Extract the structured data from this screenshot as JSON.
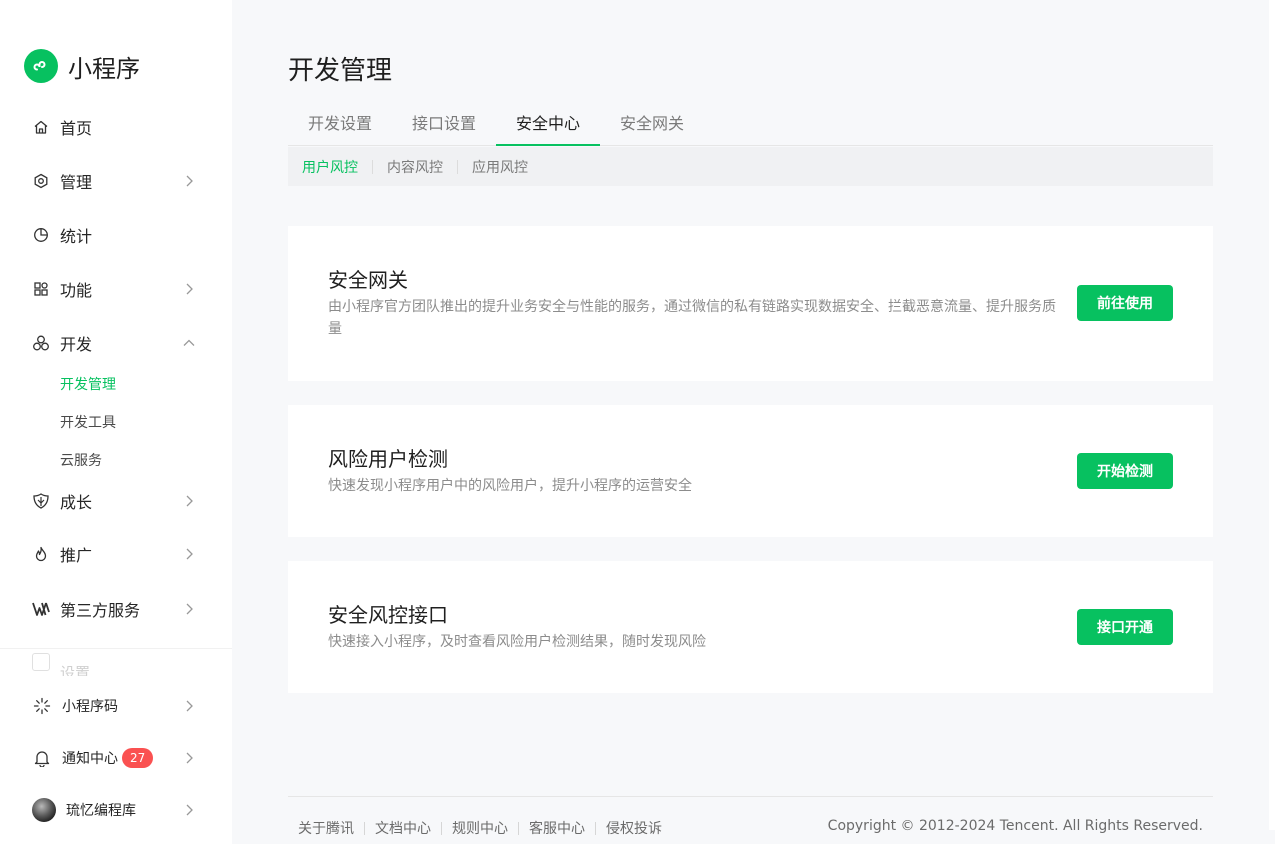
{
  "brand": {
    "name": "小程序",
    "accent": "#07c160"
  },
  "sidebar": {
    "items": [
      {
        "label": "首页",
        "icon": "home-icon"
      },
      {
        "label": "管理",
        "icon": "hexagon-icon"
      },
      {
        "label": "统计",
        "icon": "pie-chart-icon"
      },
      {
        "label": "功能",
        "icon": "grid-icon"
      },
      {
        "label": "开发",
        "icon": "circles-icon"
      },
      {
        "label": "成长",
        "icon": "shield-leaf-icon"
      },
      {
        "label": "推广",
        "icon": "flame-icon"
      },
      {
        "label": "第三方服务",
        "icon": "wing-icon"
      }
    ],
    "dev_sub": [
      "开发管理",
      "开发工具",
      "云服务"
    ],
    "faded_item": "设置",
    "bottom": {
      "qrcode": "小程序码",
      "notice": "通知中心",
      "notice_count": "27",
      "user": "琉忆编程库"
    }
  },
  "main": {
    "title": "开发管理",
    "tabs": [
      "开发设置",
      "接口设置",
      "安全中心",
      "安全网关"
    ],
    "active_tab": "安全中心",
    "subtabs": [
      "用户风控",
      "内容风控",
      "应用风控"
    ],
    "active_subtab": "用户风控",
    "cards": [
      {
        "title": "安全网关",
        "desc": "由小程序官方团队推出的提升业务安全与性能的服务，通过微信的私有链路实现数据安全、拦截恶意流量、提升服务质量",
        "button": "前往使用"
      },
      {
        "title": "风险用户检测",
        "desc": "快速发现小程序用户中的风险用户，提升小程序的运营安全",
        "button": "开始检测"
      },
      {
        "title": "安全风控接口",
        "desc": "快速接入小程序，及时查看风险用户检测结果，随时发现风险",
        "button": "接口开通"
      }
    ]
  },
  "footer": {
    "links": [
      "关于腾讯",
      "文档中心",
      "规则中心",
      "客服中心",
      "侵权投诉"
    ],
    "copyright": "Copyright © 2012-2024 Tencent. All Rights Reserved."
  }
}
